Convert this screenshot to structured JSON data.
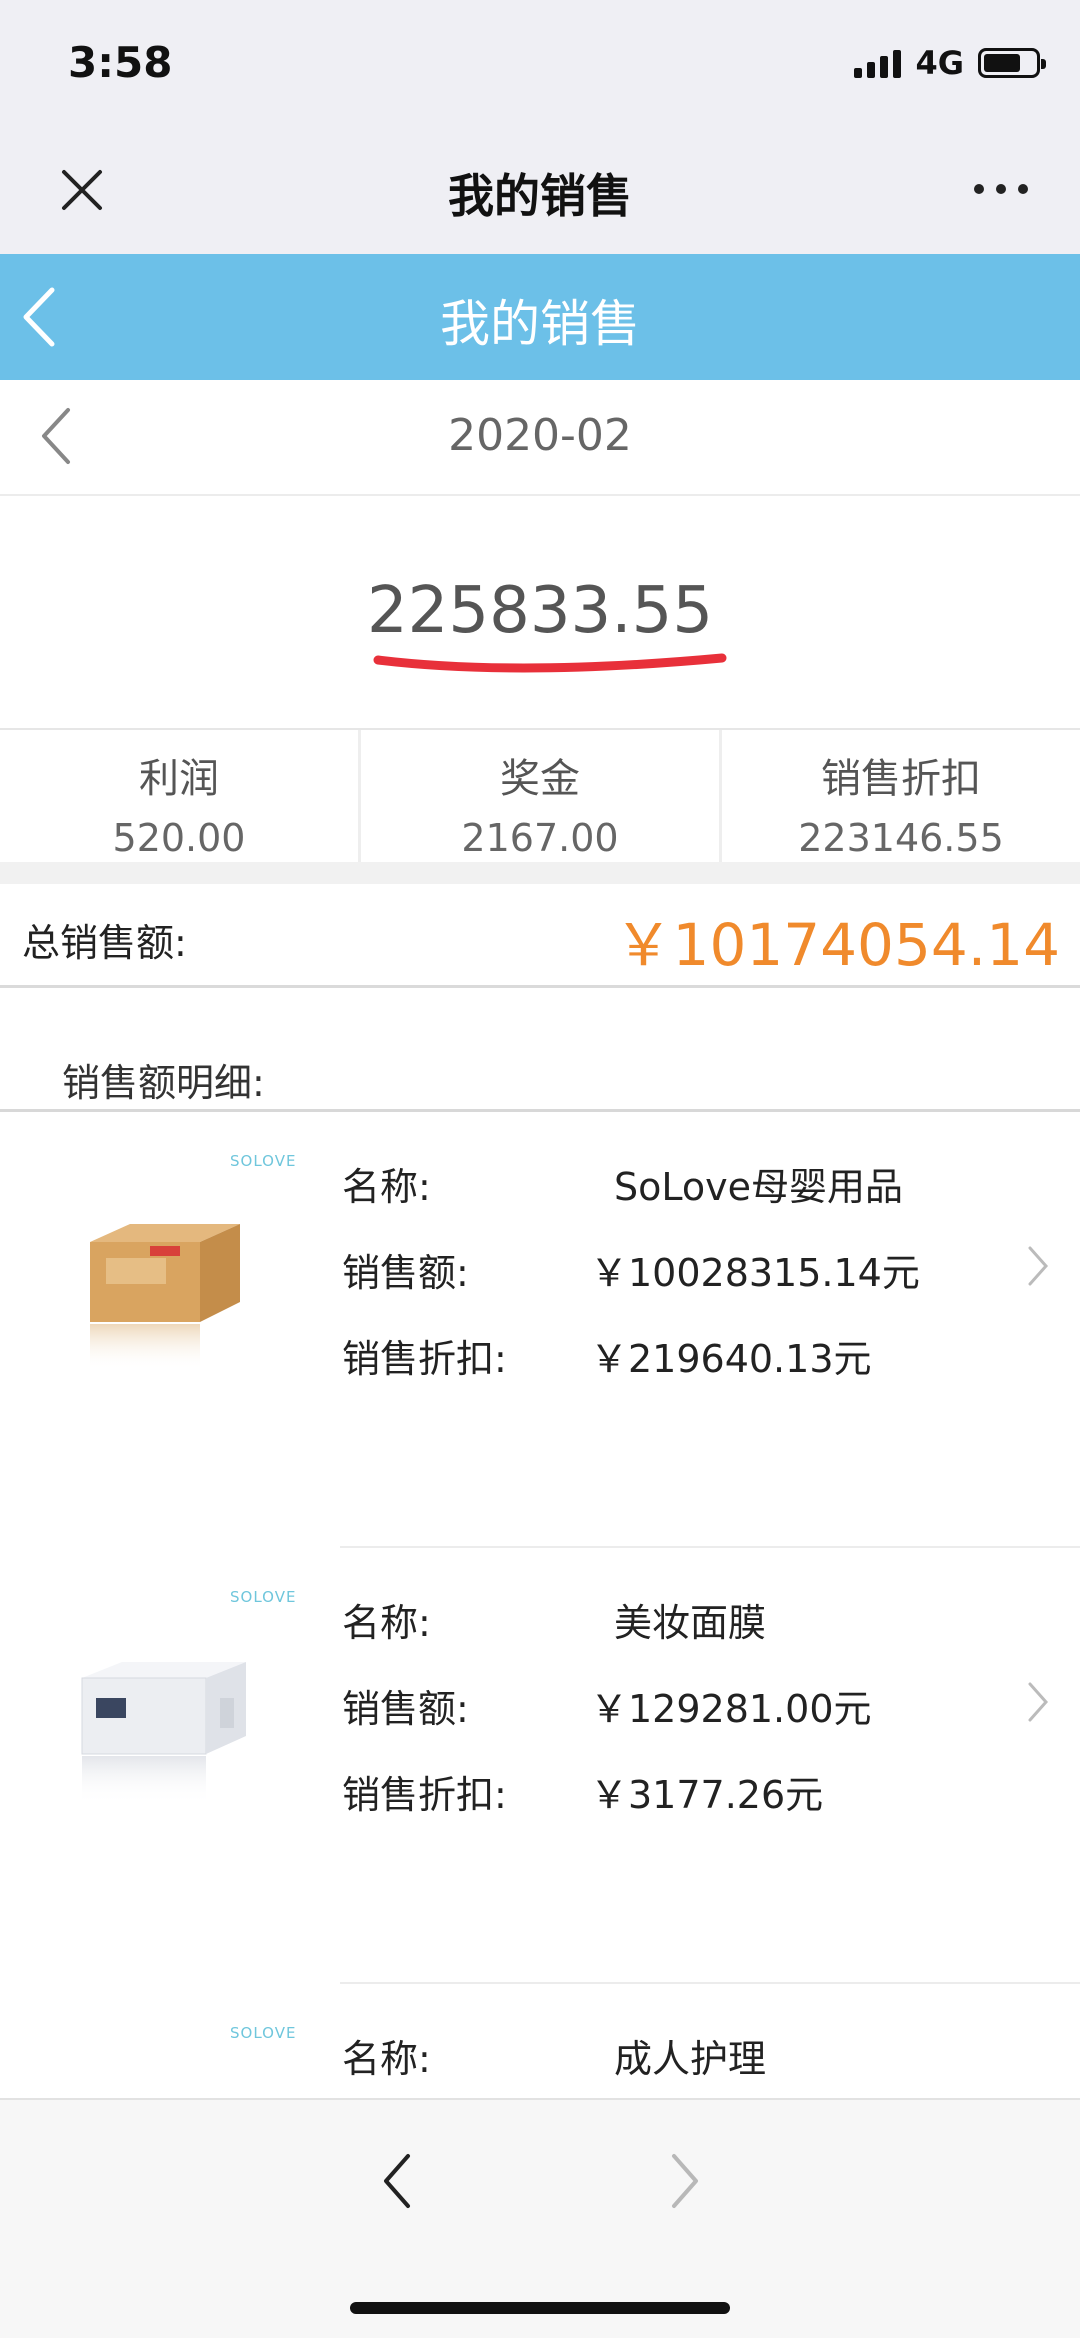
{
  "status": {
    "time": "3:58",
    "network": "4G"
  },
  "wechat_nav": {
    "title": "我的销售"
  },
  "header": {
    "title": "我的销售"
  },
  "month": "2020-02",
  "summary": {
    "amount": "225833.55"
  },
  "stats": [
    {
      "label": "利润",
      "value": "520.00"
    },
    {
      "label": "奖金",
      "value": "2167.00"
    },
    {
      "label": "销售折扣",
      "value": "223146.55"
    }
  ],
  "total": {
    "label": "总销售额:",
    "value": "￥10174054.14"
  },
  "details": {
    "title": "销售额明细:",
    "brand": "SOLOVE",
    "name_label": "名称:",
    "sales_label": "销售额:",
    "discount_label": "销售折扣:",
    "items": [
      {
        "name": "SoLove母婴用品",
        "sales": "￥10028315.14元",
        "discount": "￥219640.13元"
      },
      {
        "name": "美妆面膜",
        "sales": "￥129281.00元",
        "discount": "￥3177.26元"
      },
      {
        "name": "成人护理"
      }
    ]
  },
  "colors": {
    "header_blue": "#6cc0e8",
    "total_orange": "#f08a2c",
    "underline_red": "#e8303a"
  }
}
